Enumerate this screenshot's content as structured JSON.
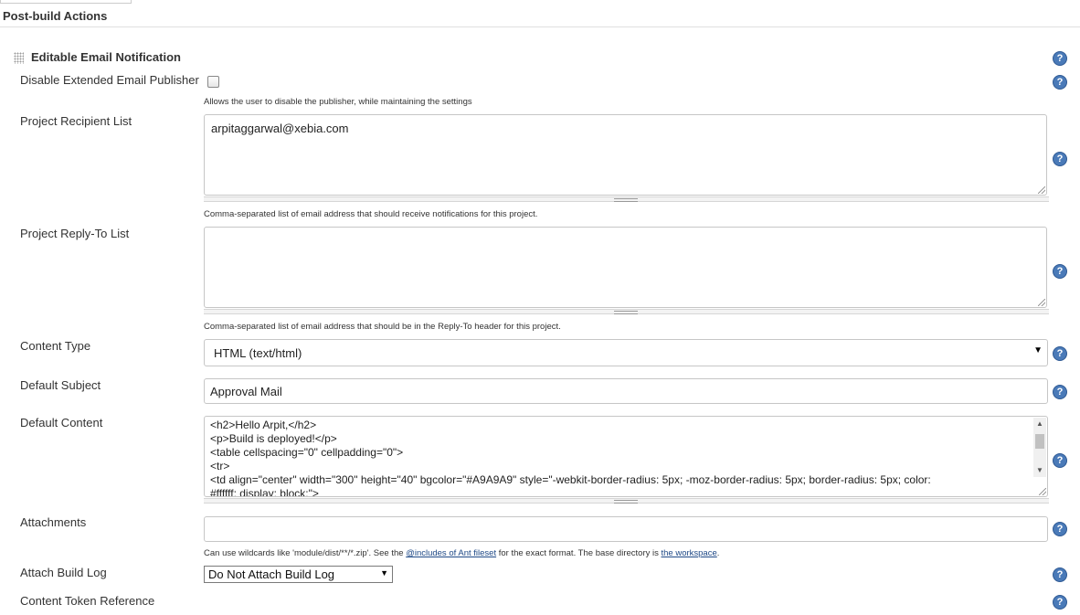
{
  "section": {
    "title": "Post-build Actions"
  },
  "block": {
    "title": "Editable Email Notification"
  },
  "icons": {
    "help": "help-icon",
    "drag": "drag-handle-icon",
    "arrow": "chevron-down-icon"
  },
  "colors": {
    "help_icon": "#4a7ab8",
    "link": "#204a87"
  },
  "fields": {
    "disable_publisher": {
      "label": "Disable Extended Email Publisher",
      "checked": false,
      "description": "Allows the user to disable the publisher, while maintaining the settings"
    },
    "recipient_list": {
      "label": "Project Recipient List",
      "value": "arpitaggarwal@xebia.com",
      "description": "Comma-separated list of email address that should receive notifications for this project."
    },
    "reply_to": {
      "label": "Project Reply-To List",
      "value": "",
      "description": "Comma-separated list of email address that should be in the Reply-To header for this project."
    },
    "content_type": {
      "label": "Content Type",
      "value": "HTML (text/html)"
    },
    "default_subject": {
      "label": "Default Subject",
      "value": "Approval Mail"
    },
    "default_content": {
      "label": "Default Content",
      "lines": [
        "<h2>Hello Arpit,</h2>",
        "<p>Build is deployed!</p>",
        "<table cellspacing=\"0\" cellpadding=\"0\">",
        "<tr>",
        "<td align=\"center\" width=\"300\" height=\"40\" bgcolor=\"#A9A9A9\" style=\"-webkit-border-radius: 5px; -moz-border-radius: 5px; border-radius: 5px; color:",
        "#ffffff; display: block;\">"
      ]
    },
    "attachments": {
      "label": "Attachments",
      "value": "",
      "desc_prefix": "Can use wildcards like 'module/dist/**/*.zip'. See the ",
      "desc_link1": "@includes of Ant fileset",
      "desc_middle": " for the exact format. The base directory is ",
      "desc_link2": "the workspace",
      "desc_suffix": "."
    },
    "attach_build_log": {
      "label": "Attach Build Log",
      "value": "Do Not Attach Build Log"
    },
    "content_token": {
      "label": "Content Token Reference"
    }
  }
}
